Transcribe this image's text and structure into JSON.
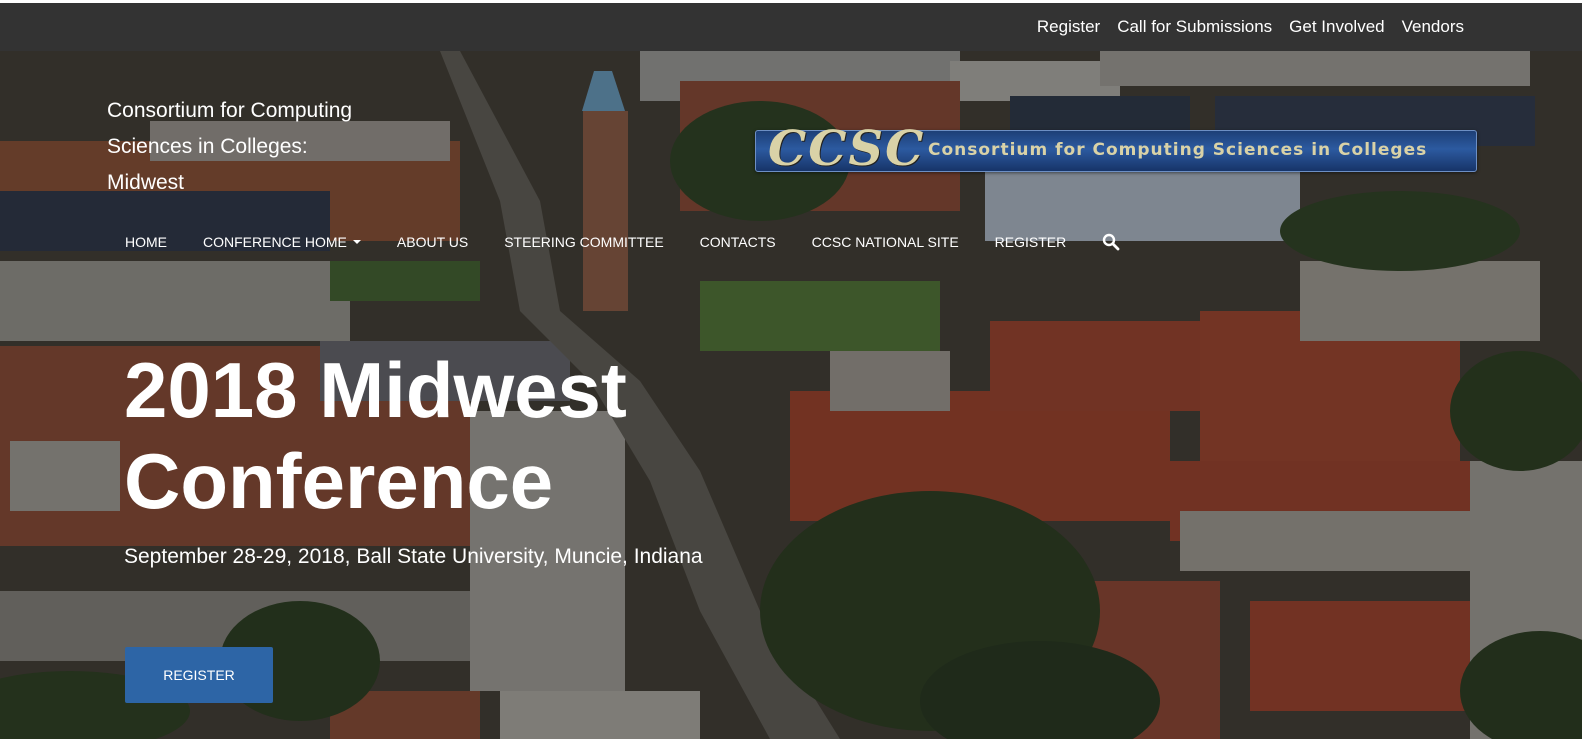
{
  "topbar": {
    "links": [
      "Register",
      "Call for Submissions",
      "Get Involved",
      "Vendors"
    ]
  },
  "site": {
    "title_lines": [
      "Consortium for Computing",
      "Sciences in Colleges:",
      "Midwest"
    ]
  },
  "logo": {
    "mark": "CCSC",
    "tagline": "Consortium for Computing Sciences in Colleges"
  },
  "nav": {
    "items": [
      {
        "label": "HOME"
      },
      {
        "label": "CONFERENCE HOME",
        "has_dropdown": true
      },
      {
        "label": "ABOUT US"
      },
      {
        "label": "STEERING COMMITTEE"
      },
      {
        "label": "CONTACTS"
      },
      {
        "label": "CCSC NATIONAL SITE"
      },
      {
        "label": "REGISTER"
      }
    ],
    "search_icon": "search-icon"
  },
  "hero": {
    "headline_lines": [
      "2018 Midwest",
      "Conference"
    ],
    "subtitle": "September 28-29, 2018, Ball State University, Muncie, Indiana",
    "cta_label": "REGISTER"
  },
  "colors": {
    "topbar": "#333333",
    "button": "#2d65a6",
    "text": "#ffffff"
  }
}
